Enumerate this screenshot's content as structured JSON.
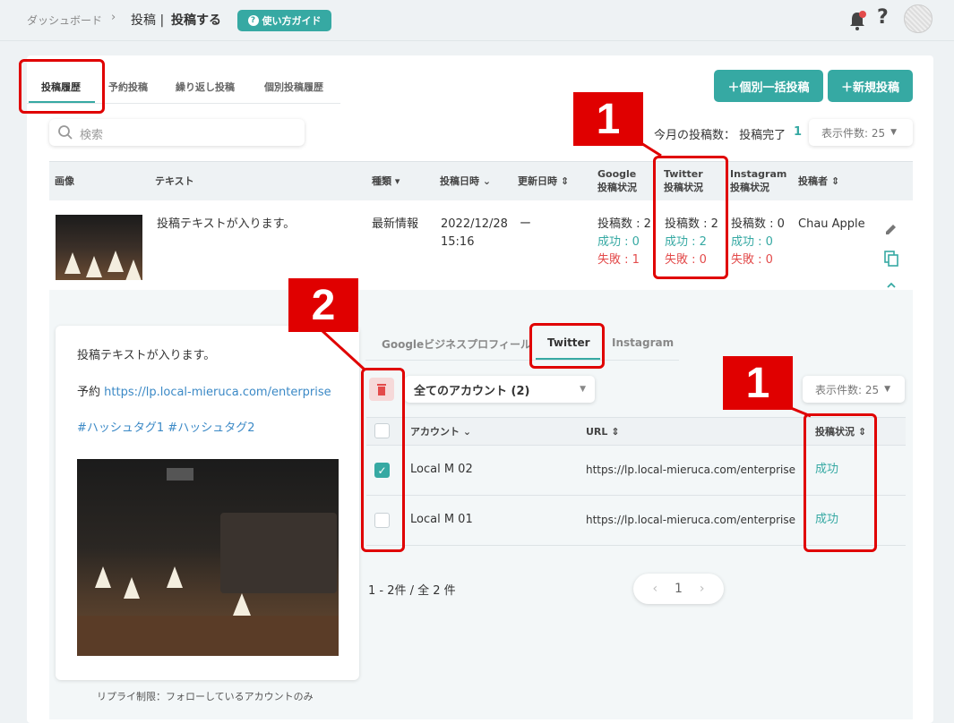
{
  "breadcrumb": {
    "dashboard": "ダッシュボード",
    "sep": "›",
    "post": "投稿",
    "pipe_current": "投稿する"
  },
  "guide_button": "使い方ガイド",
  "help_label": "?",
  "tabs": [
    "投稿履歴",
    "予約投稿",
    "繰り返し投稿",
    "個別投稿履歴"
  ],
  "actions": {
    "bulk": "＋個別一括投稿",
    "new": "＋新規投稿"
  },
  "search": {
    "placeholder": "検索"
  },
  "monthly": {
    "label": "今月の投稿数： 投稿完了",
    "count": "1"
  },
  "per_page": "表示件数: 25",
  "columns": {
    "image": "画像",
    "text": "テキスト",
    "type": "種類",
    "posted_at": "投稿日時",
    "updated_at": "更新日時",
    "google1": "Google",
    "google2": "投稿状況",
    "twitter1": "Twitter",
    "twitter2": "投稿状況",
    "instagram1": "Instagram",
    "instagram2": "投稿状況",
    "author": "投稿者"
  },
  "row": {
    "text": "投稿テキストが入ります。",
    "type": "最新情報",
    "date": "2022/12/28",
    "time": "15:16",
    "updated": "ー",
    "google": {
      "count": "投稿数 : 2",
      "ok": "成功 : 0",
      "ng": "失敗 : 1"
    },
    "twitter": {
      "count": "投稿数 : 2",
      "ok": "成功 : 2",
      "ng": "失敗 : 0"
    },
    "instagram": {
      "count": "投稿数 : 0",
      "ok": "成功 : 0",
      "ng": "失敗 : 0"
    },
    "author": "Chau Apple"
  },
  "preview": {
    "text": "投稿テキストが入ります。",
    "reserve_prefix": "予約",
    "reserve_url": "https://lp.local-mieruca.com/enterprise",
    "hashtags": "#ハッシュタグ1 #ハッシュタグ2",
    "reply_limit": "リプライ制限：フォローしているアカウントのみ"
  },
  "sub_tabs": [
    "Googleビジネスプロフィール",
    "Twitter",
    "Instagram"
  ],
  "account_filter": "全てのアカウント (2)",
  "sub_per_page": "表示件数: 25",
  "sub_columns": {
    "account": "アカウント",
    "url": "URL",
    "status": "投稿状況"
  },
  "sub_rows": [
    {
      "account": "Local M 02",
      "url": "https://lp.local-mieruca.com/enterprise",
      "status": "成功",
      "checked": true
    },
    {
      "account": "Local M 01",
      "url": "https://lp.local-mieruca.com/enterprise",
      "status": "成功",
      "checked": false
    }
  ],
  "summary": "1 - 2件 / 全 2 件",
  "pager": {
    "prev": "‹",
    "page": "1",
    "next": "›"
  },
  "annotations": [
    "1",
    "2",
    "1"
  ],
  "colors": {
    "accent": "#36a9a3",
    "error": "#e34b4b",
    "annotation": "#e00000"
  }
}
